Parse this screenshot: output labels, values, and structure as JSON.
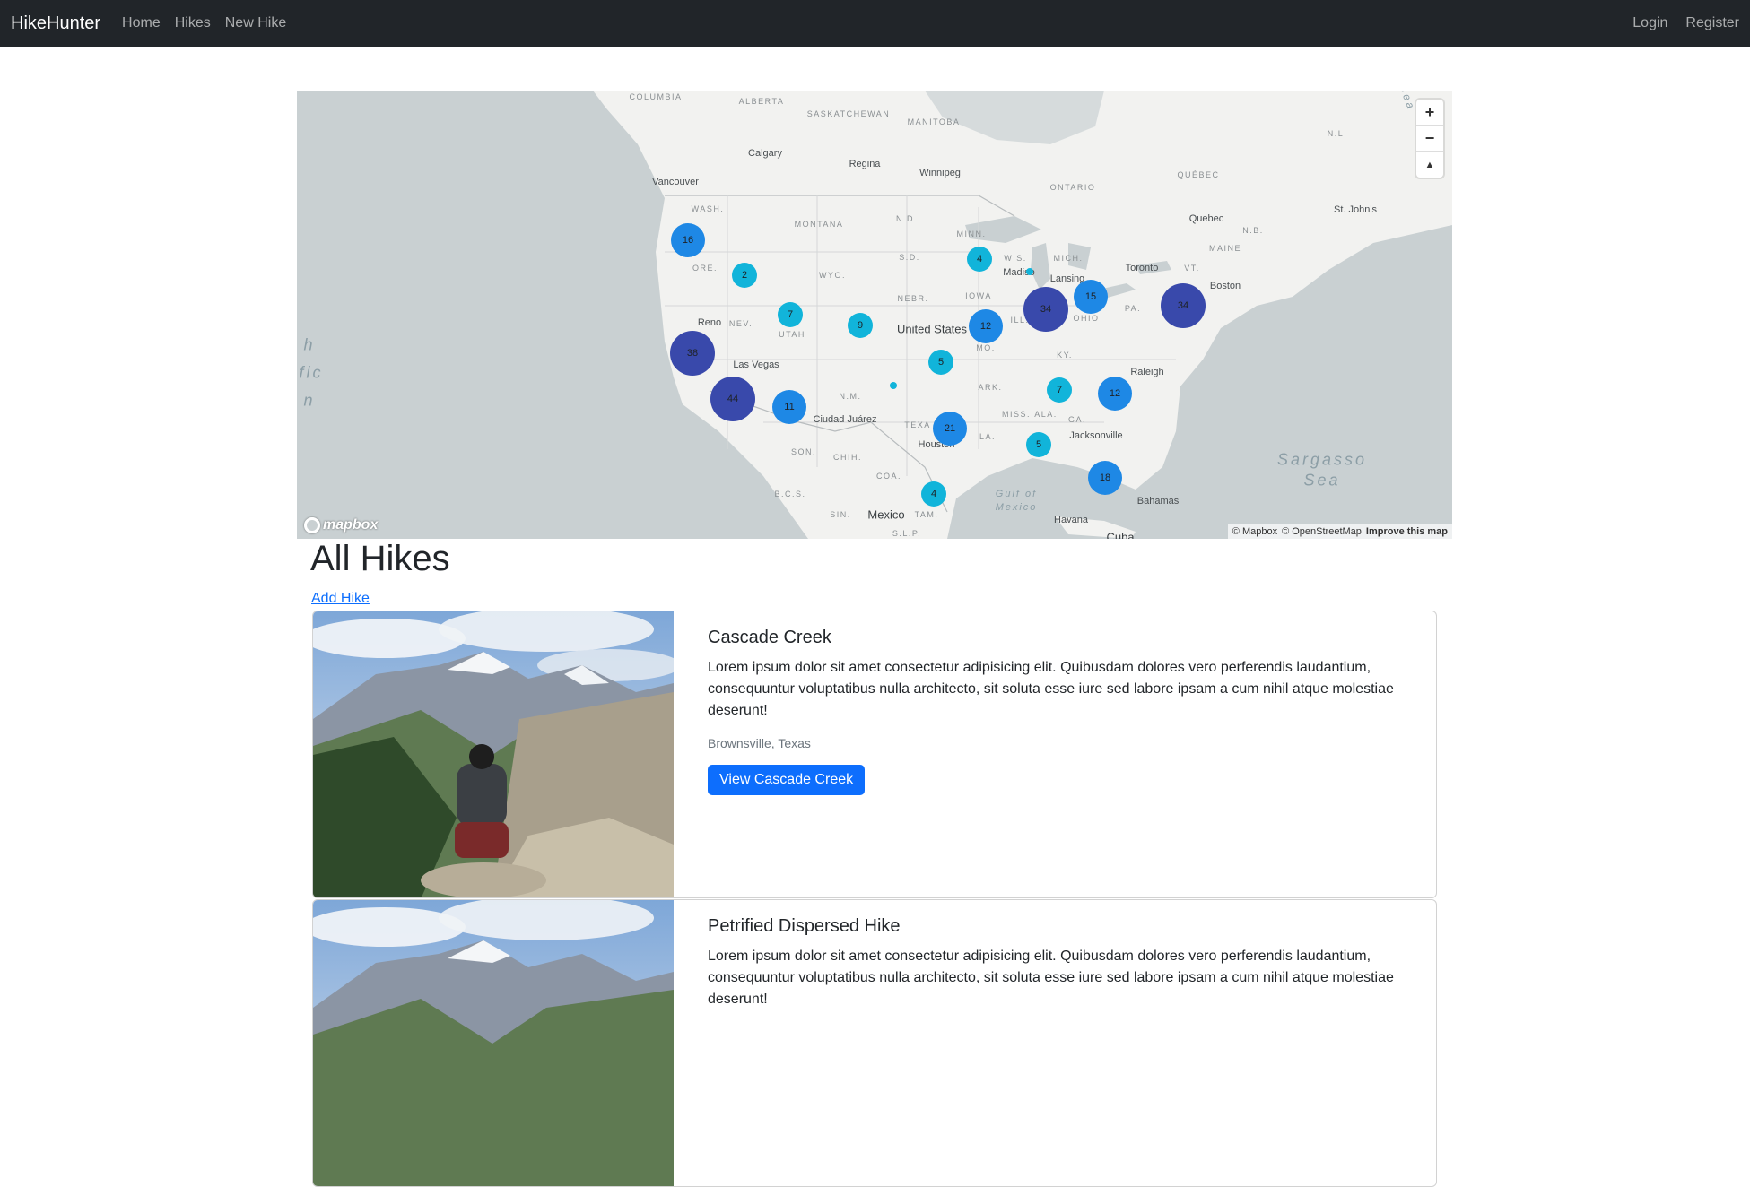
{
  "navbar": {
    "brand": "HikeHunter",
    "links": [
      "Home",
      "Hikes",
      "New Hike"
    ],
    "right_links": [
      "Login",
      "Register"
    ]
  },
  "map": {
    "labels": {
      "columbia": "COLUMBIA",
      "alberta": "ALBERTA",
      "saskatchewan": "SASKATCHEWAN",
      "manitoba": "MANITOBA",
      "ontario": "ONTARIO",
      "quebec": "QUÉBEC",
      "nb": "N.B.",
      "nl": "N.L.",
      "wash": "WASH.",
      "ore": "ORE.",
      "nev": "NEV.",
      "utah": "UTAH",
      "montana": "MONTANA",
      "wyo": "WYO.",
      "nd": "N.D.",
      "sd": "S.D.",
      "nebr": "NEBR.",
      "iowa": "IOWA",
      "minn": "MINN.",
      "wis": "WIS.",
      "mich": "MICH.",
      "ohio": "OHIO",
      "pa": "PA.",
      "vt": "VT.",
      "maine": "MAINE",
      "mo": "MO.",
      "ky": "KY.",
      "ark": "ARK.",
      "miss": "MISS.",
      "ala": "ALA.",
      "ga": "GA.",
      "nm": "N.M.",
      "tex": "TEXA",
      "la": "LA.",
      "son": "SON.",
      "chih": "CHIH.",
      "coa": "COA.",
      "sin": "SIN.",
      "tam": "TAM.",
      "bcs": "B.C.S.",
      "slp": "S.L.P.",
      "ill": "ILL.",
      "calgary": "Calgary",
      "regina": "Regina",
      "winnipeg": "Winnipeg",
      "vancouver": "Vancouver",
      "reno": "Reno",
      "las_vegas": "Las Vegas",
      "ciudad_juarez": "Ciudad Juárez",
      "houston": "Houston",
      "madison": "Madiso",
      "lansing": "Lansing",
      "toronto": "Toronto",
      "quebec_city": "Quebec",
      "boston": "Boston",
      "raleigh": "Raleigh",
      "jacksonville": "Jacksonville",
      "st_johns": "St. John's",
      "bahamas": "Bahamas",
      "havana": "Havana",
      "cuba": "Cuba",
      "mexico": "Mexico",
      "united_states": "United States",
      "gulf1": "Gulf of",
      "gulf2": "Mexico",
      "sargasso1": "Sargasso",
      "sargasso2": "Sea",
      "pacific1": "h",
      "pacific2": "fic",
      "pacific3": "n",
      "sea_corner": "Sea"
    },
    "clusters": [
      {
        "count": "16",
        "color": "#1e88e5"
      },
      {
        "count": "2",
        "color": "#11b4da"
      },
      {
        "count": "7",
        "color": "#11b4da"
      },
      {
        "count": "9",
        "color": "#11b4da"
      },
      {
        "count": "38",
        "color": "#3949ab"
      },
      {
        "count": "44",
        "color": "#3949ab"
      },
      {
        "count": "11",
        "color": "#1e88e5"
      },
      {
        "count": "5",
        "color": "#11b4da"
      },
      {
        "count": "4",
        "color": "#11b4da"
      },
      {
        "count": "12",
        "color": "#1e88e5"
      },
      {
        "count": "34",
        "color": "#3949ab"
      },
      {
        "count": "15",
        "color": "#1e88e5"
      },
      {
        "count": "34",
        "color": "#3949ab"
      },
      {
        "count": "7",
        "color": "#11b4da"
      },
      {
        "count": "12",
        "color": "#1e88e5"
      },
      {
        "count": "21",
        "color": "#1e88e5"
      },
      {
        "count": "5",
        "color": "#11b4da"
      },
      {
        "count": "18",
        "color": "#1e88e5"
      },
      {
        "count": "4",
        "color": "#11b4da"
      }
    ],
    "controls": {
      "zoom_in": "+",
      "zoom_out": "−",
      "compass": "▲"
    },
    "logo": "mapbox",
    "attribution": {
      "mapbox": "© Mapbox",
      "osm": "© OpenStreetMap",
      "improve": "Improve this map"
    }
  },
  "page": {
    "title": "All Hikes",
    "add_link": "Add Hike"
  },
  "hikes": [
    {
      "title": "Cascade Creek",
      "description": "Lorem ipsum dolor sit amet consectetur adipisicing elit. Quibusdam dolores vero perferendis laudantium, consequuntur voluptatibus nulla architecto, sit soluta esse iure sed labore ipsam a cum nihil atque molestiae deserunt!",
      "location": "Brownsville, Texas",
      "button": "View Cascade Creek"
    },
    {
      "title": "Petrified Dispersed Hike",
      "description": "Lorem ipsum dolor sit amet consectetur adipisicing elit. Quibusdam dolores vero perferendis laudantium, consequuntur voluptatibus nulla architecto, sit soluta esse iure sed labore ipsam a cum nihil atque molestiae deserunt!",
      "location": "",
      "button": ""
    }
  ]
}
